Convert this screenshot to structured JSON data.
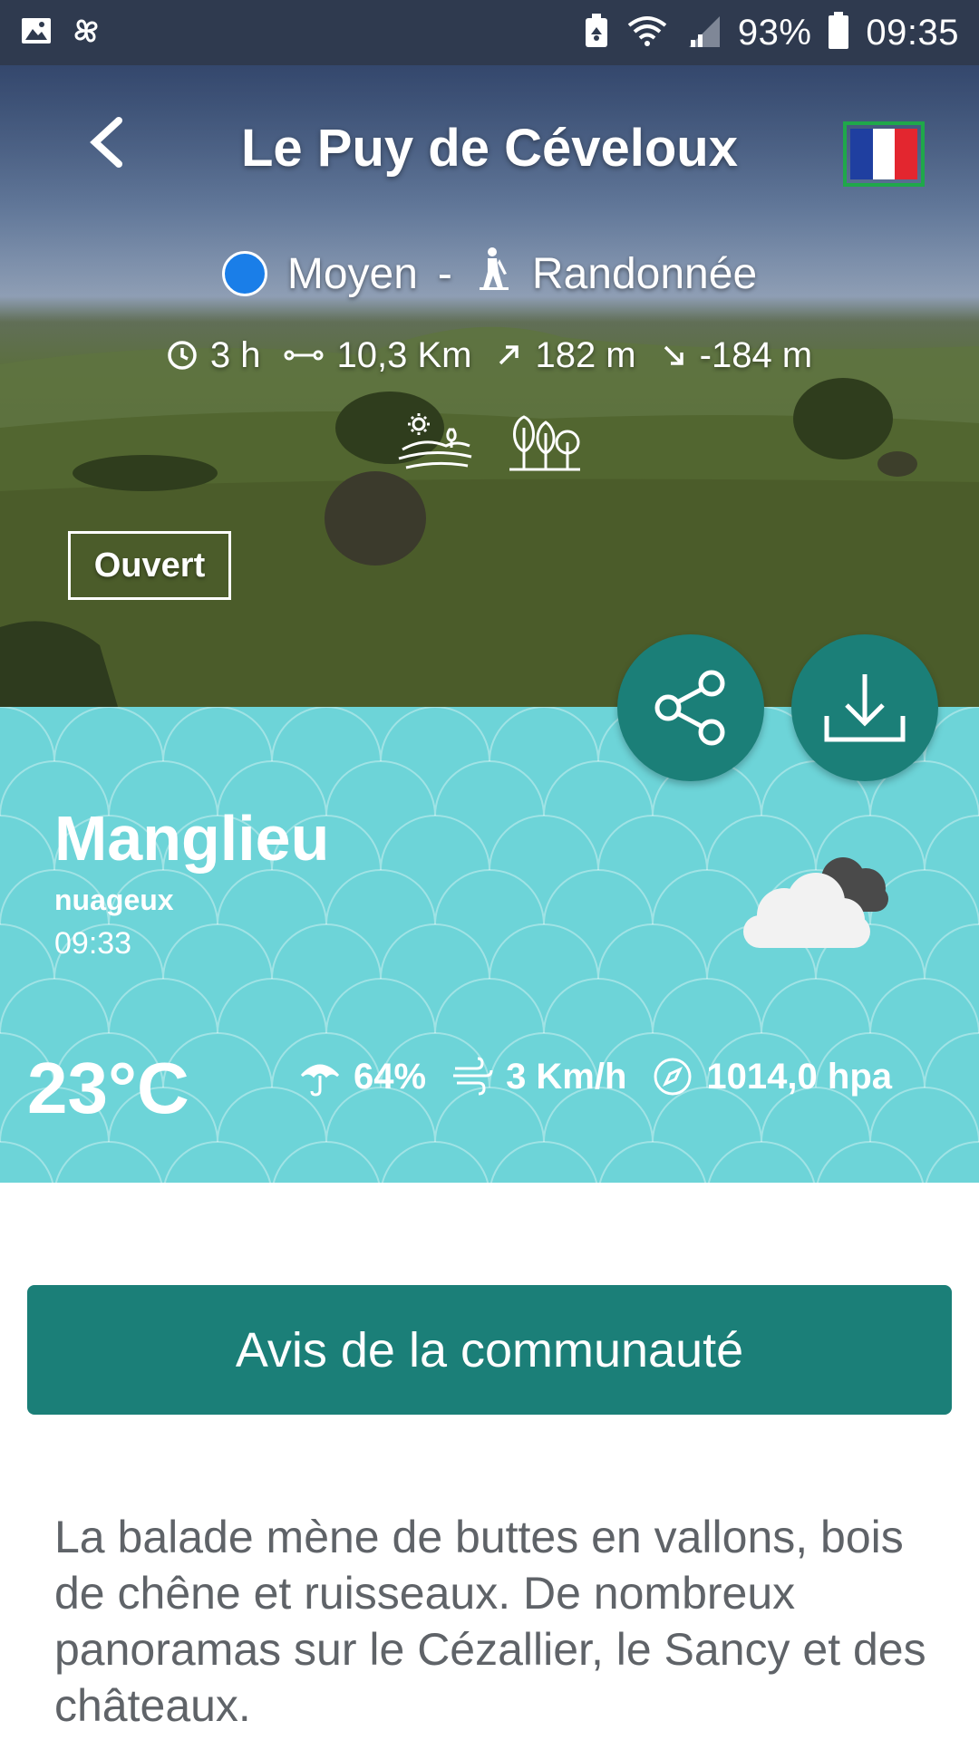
{
  "status_bar": {
    "battery_percent": "93%",
    "time": "09:35"
  },
  "hero": {
    "title": "Le Puy de Céveloux",
    "difficulty": "Moyen",
    "separator": "-",
    "activity": "Randonnée",
    "difficulty_color": "#1a7ee8",
    "stats": {
      "duration": "3 h",
      "distance": "10,3 Km",
      "ascent": "182 m",
      "descent": "-184 m"
    },
    "theme_icons": [
      "landscape-icon",
      "forest-icon"
    ],
    "status": "Ouvert"
  },
  "weather": {
    "city": "Manglieu",
    "condition": "nuageux",
    "time": "09:33",
    "temperature": "23°C",
    "humidity": "64%",
    "wind": "3 Km/h",
    "pressure": "1014,0 hpa",
    "icon": "cloudy-icon",
    "background_color": "#6dd4d8"
  },
  "actions": {
    "share": "share-icon",
    "download": "download-icon",
    "community_label": "Avis de la communauté",
    "accent_color": "#1b7f78"
  },
  "description": "La balade mène de buttes en vallons, bois de chêne et ruisseaux. De nombreux panoramas sur le Cézallier, le Sancy et des châteaux."
}
